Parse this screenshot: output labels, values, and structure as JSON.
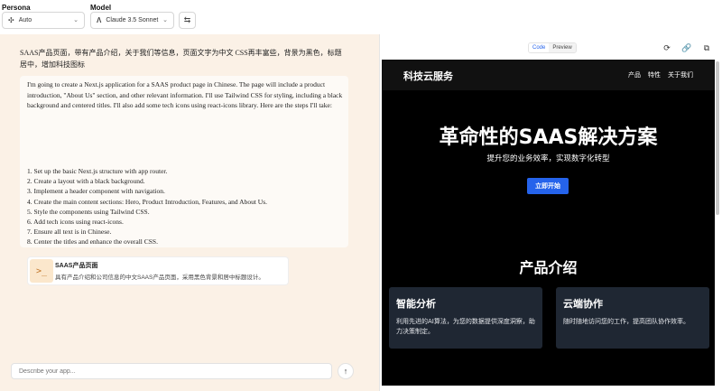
{
  "topbar": {
    "persona_label": "Persona",
    "persona_value": "Auto",
    "persona_icon": "sparkle-icon",
    "model_label": "Model",
    "model_value": "Claude 3.5 Sonnet",
    "model_icon": "anthropic-icon",
    "swap_icon": "swap-icon"
  },
  "chat": {
    "user_message": "SAAS产品页面，带有产品介绍，关于我们等信息，页面文字为中文 CSS再丰富些，背景为黑色，标题居中，增加科技图标",
    "assistant_intro": "I'm going to create a Next.js application for a SAAS product page in Chinese. The page will include a product introduction, \"About Us\" section, and other relevant information. I'll use Tailwind CSS for styling, including a black background and centered titles. I'll also add some tech icons using react-icons library. Here are the steps I'll take:",
    "steps": [
      "1. Set up the basic Next.js structure with app router.",
      "2. Create a layout with a black background.",
      "3. Implement a header component with navigation.",
      "4. Create the main content sections: Hero, Product Introduction, Features, and About Us.",
      "5. Style the components using Tailwind CSS.",
      "6. Add tech icons using react-icons.",
      "7. Ensure all text is in Chinese.",
      "8. Center the titles and enhance the overall CSS."
    ],
    "artifact": {
      "icon": "terminal-icon",
      "title": "SAAS产品页面",
      "description": "具有产品介绍和公司信息的中文SAAS产品页面，采用黑色背景和居中标题设计。"
    },
    "input_placeholder": "Describe your app...",
    "send_icon": "arrow-up-icon"
  },
  "preview": {
    "tabs": [
      "Code",
      "Preview"
    ],
    "toolbar_icons": [
      "refresh-icon",
      "link-icon",
      "copy-icon"
    ],
    "site": {
      "brand": "科技云服务",
      "nav": [
        "产品",
        "特性",
        "关于我们"
      ],
      "hero_title": "革命性的SAAS解决方案",
      "hero_subtitle": "提升您的业务效率，实现数字化转型",
      "cta": "立即开始",
      "section_title": "产品介绍",
      "features": [
        {
          "title": "智能分析",
          "desc": "利用先进的AI算法，为您的数据提供深度洞察，助力决策制定。"
        },
        {
          "title": "云端协作",
          "desc": "随时随地访问您的工作，提高团队协作效率。"
        }
      ]
    }
  },
  "colors": {
    "left_panel_bg": "#fbf1e6",
    "site_bg": "#000000",
    "cta_blue": "#2563eb",
    "card_bg": "#1f2733"
  }
}
